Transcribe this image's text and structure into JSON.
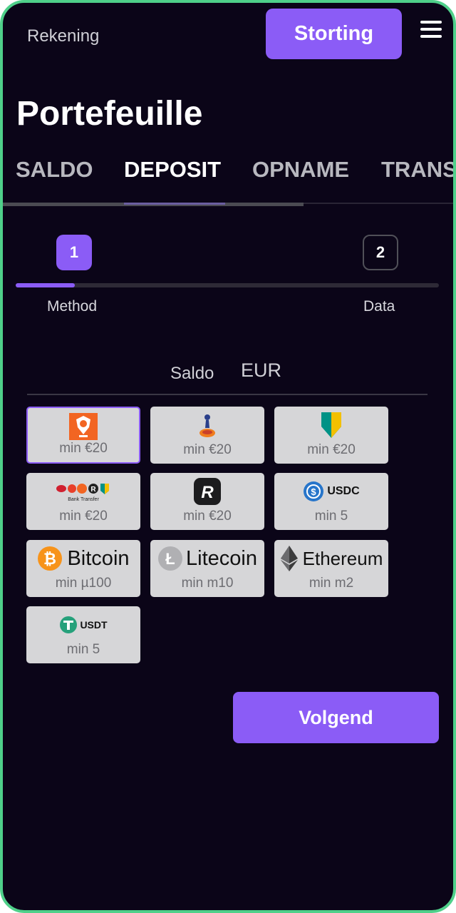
{
  "header": {
    "account_label": "Rekening",
    "deposit_button_label": "Storting"
  },
  "page": {
    "title": "Portefeuille"
  },
  "tabs": [
    {
      "label": "SALDO"
    },
    {
      "label": "DEPOSIT",
      "active": true
    },
    {
      "label": "OPNAME"
    },
    {
      "label": "TRANS"
    }
  ],
  "stepper": {
    "steps": [
      {
        "number": "1",
        "label": "Method",
        "active": true
      },
      {
        "number": "2",
        "label": "Data"
      }
    ],
    "progress": 0.14
  },
  "currency": {
    "caption": "Saldo",
    "value": "EUR"
  },
  "methods": [
    {
      "id": "ing",
      "min": "min €20",
      "selected": true
    },
    {
      "id": "rabobank",
      "min": "min €20"
    },
    {
      "id": "abn-amro",
      "min": "min €20"
    },
    {
      "id": "bank-transfer",
      "logo_text": "Bank Transfer",
      "min": "min €20"
    },
    {
      "id": "revolut",
      "min": "min €20"
    },
    {
      "id": "usdc",
      "logo_text": "USDC",
      "min": "min 5"
    },
    {
      "id": "bitcoin",
      "logo_text": "Bitcoin",
      "min": "min µ100"
    },
    {
      "id": "litecoin",
      "logo_text": "Litecoin",
      "min": "min m10"
    },
    {
      "id": "ethereum",
      "logo_text": "Ethereum",
      "min": "min m2"
    },
    {
      "id": "usdt",
      "logo_text": "USDT",
      "min": "min 5"
    }
  ],
  "next_button_label": "Volgend",
  "colors": {
    "accent": "#8b5cf6",
    "background": "#0b0518",
    "frame_border": "#4fd08a",
    "tile_background": "#d6d6d8"
  }
}
